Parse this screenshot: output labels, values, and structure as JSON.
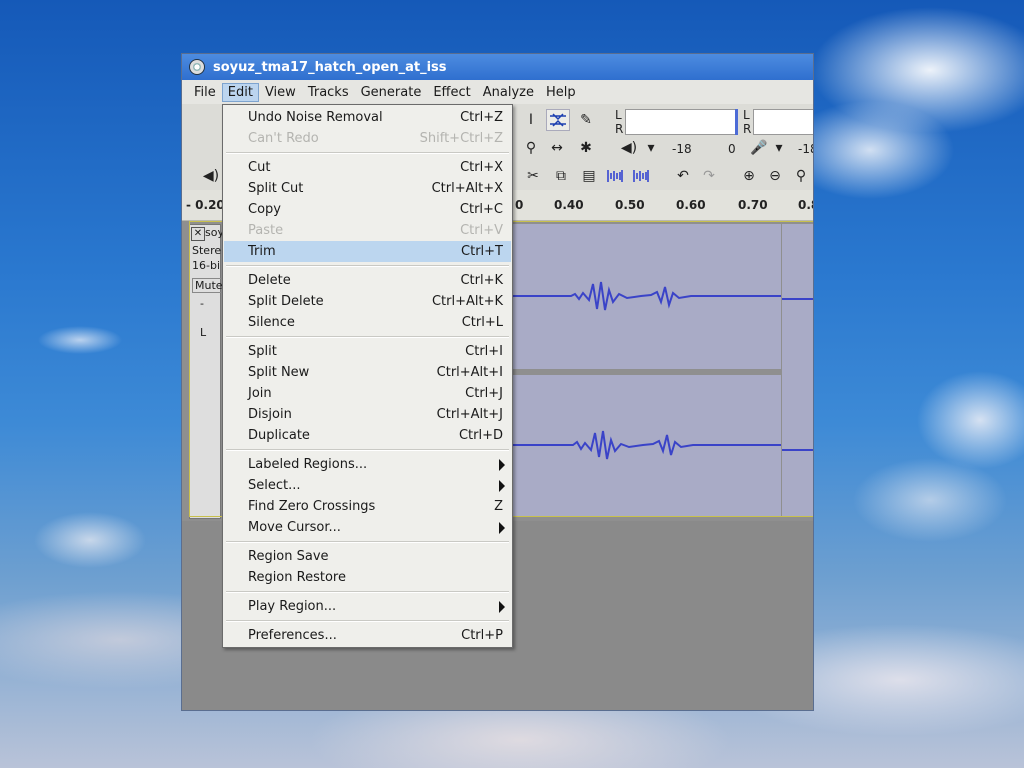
{
  "window": {
    "title": "soyuz_tma17_hatch_open_at_iss"
  },
  "menubar": [
    "File",
    "Edit",
    "View",
    "Tracks",
    "Generate",
    "Effect",
    "Analyze",
    "Help"
  ],
  "toolbar": {
    "meter_left_label": "L",
    "meter_right_label": "R",
    "meter_left_label2": "L",
    "meter_right_label2": "R",
    "db_a": "-18",
    "db_b": "0",
    "db_c": "-18"
  },
  "ruler": {
    "labels": [
      "- 0.20",
      "0",
      "0.40",
      "0.50",
      "0.60",
      "0.70",
      "0.8"
    ]
  },
  "track": {
    "name_fragment": "soy",
    "info_line1": "Stere",
    "info_line2": "16-bi",
    "mute_label": "Mute",
    "minus": "-",
    "pan_l": "L"
  },
  "edit_menu": {
    "undo": {
      "label": "Undo Noise Removal",
      "shortcut": "Ctrl+Z"
    },
    "redo": {
      "label": "Can't Redo",
      "shortcut": "Shift+Ctrl+Z"
    },
    "cut": {
      "label": "Cut",
      "shortcut": "Ctrl+X"
    },
    "split_cut": {
      "label": "Split Cut",
      "shortcut": "Ctrl+Alt+X"
    },
    "copy": {
      "label": "Copy",
      "shortcut": "Ctrl+C"
    },
    "paste": {
      "label": "Paste",
      "shortcut": "Ctrl+V"
    },
    "trim": {
      "label": "Trim",
      "shortcut": "Ctrl+T"
    },
    "delete": {
      "label": "Delete",
      "shortcut": "Ctrl+K"
    },
    "split_delete": {
      "label": "Split Delete",
      "shortcut": "Ctrl+Alt+K"
    },
    "silence": {
      "label": "Silence",
      "shortcut": "Ctrl+L"
    },
    "split": {
      "label": "Split",
      "shortcut": "Ctrl+I"
    },
    "split_new": {
      "label": "Split New",
      "shortcut": "Ctrl+Alt+I"
    },
    "join": {
      "label": "Join",
      "shortcut": "Ctrl+J"
    },
    "disjoin": {
      "label": "Disjoin",
      "shortcut": "Ctrl+Alt+J"
    },
    "duplicate": {
      "label": "Duplicate",
      "shortcut": "Ctrl+D"
    },
    "labeled_regions": {
      "label": "Labeled Regions..."
    },
    "select": {
      "label": "Select..."
    },
    "find_zero": {
      "label": "Find Zero Crossings",
      "shortcut": "Z"
    },
    "move_cursor": {
      "label": "Move Cursor..."
    },
    "region_save": {
      "label": "Region Save"
    },
    "region_restore": {
      "label": "Region Restore"
    },
    "play_region": {
      "label": "Play Region..."
    },
    "preferences": {
      "label": "Preferences...",
      "shortcut": "Ctrl+P"
    }
  },
  "colors": {
    "titlebar": "#2f6fcf",
    "waveform": "#3a43c8",
    "highlight": "#bcd6ef"
  }
}
